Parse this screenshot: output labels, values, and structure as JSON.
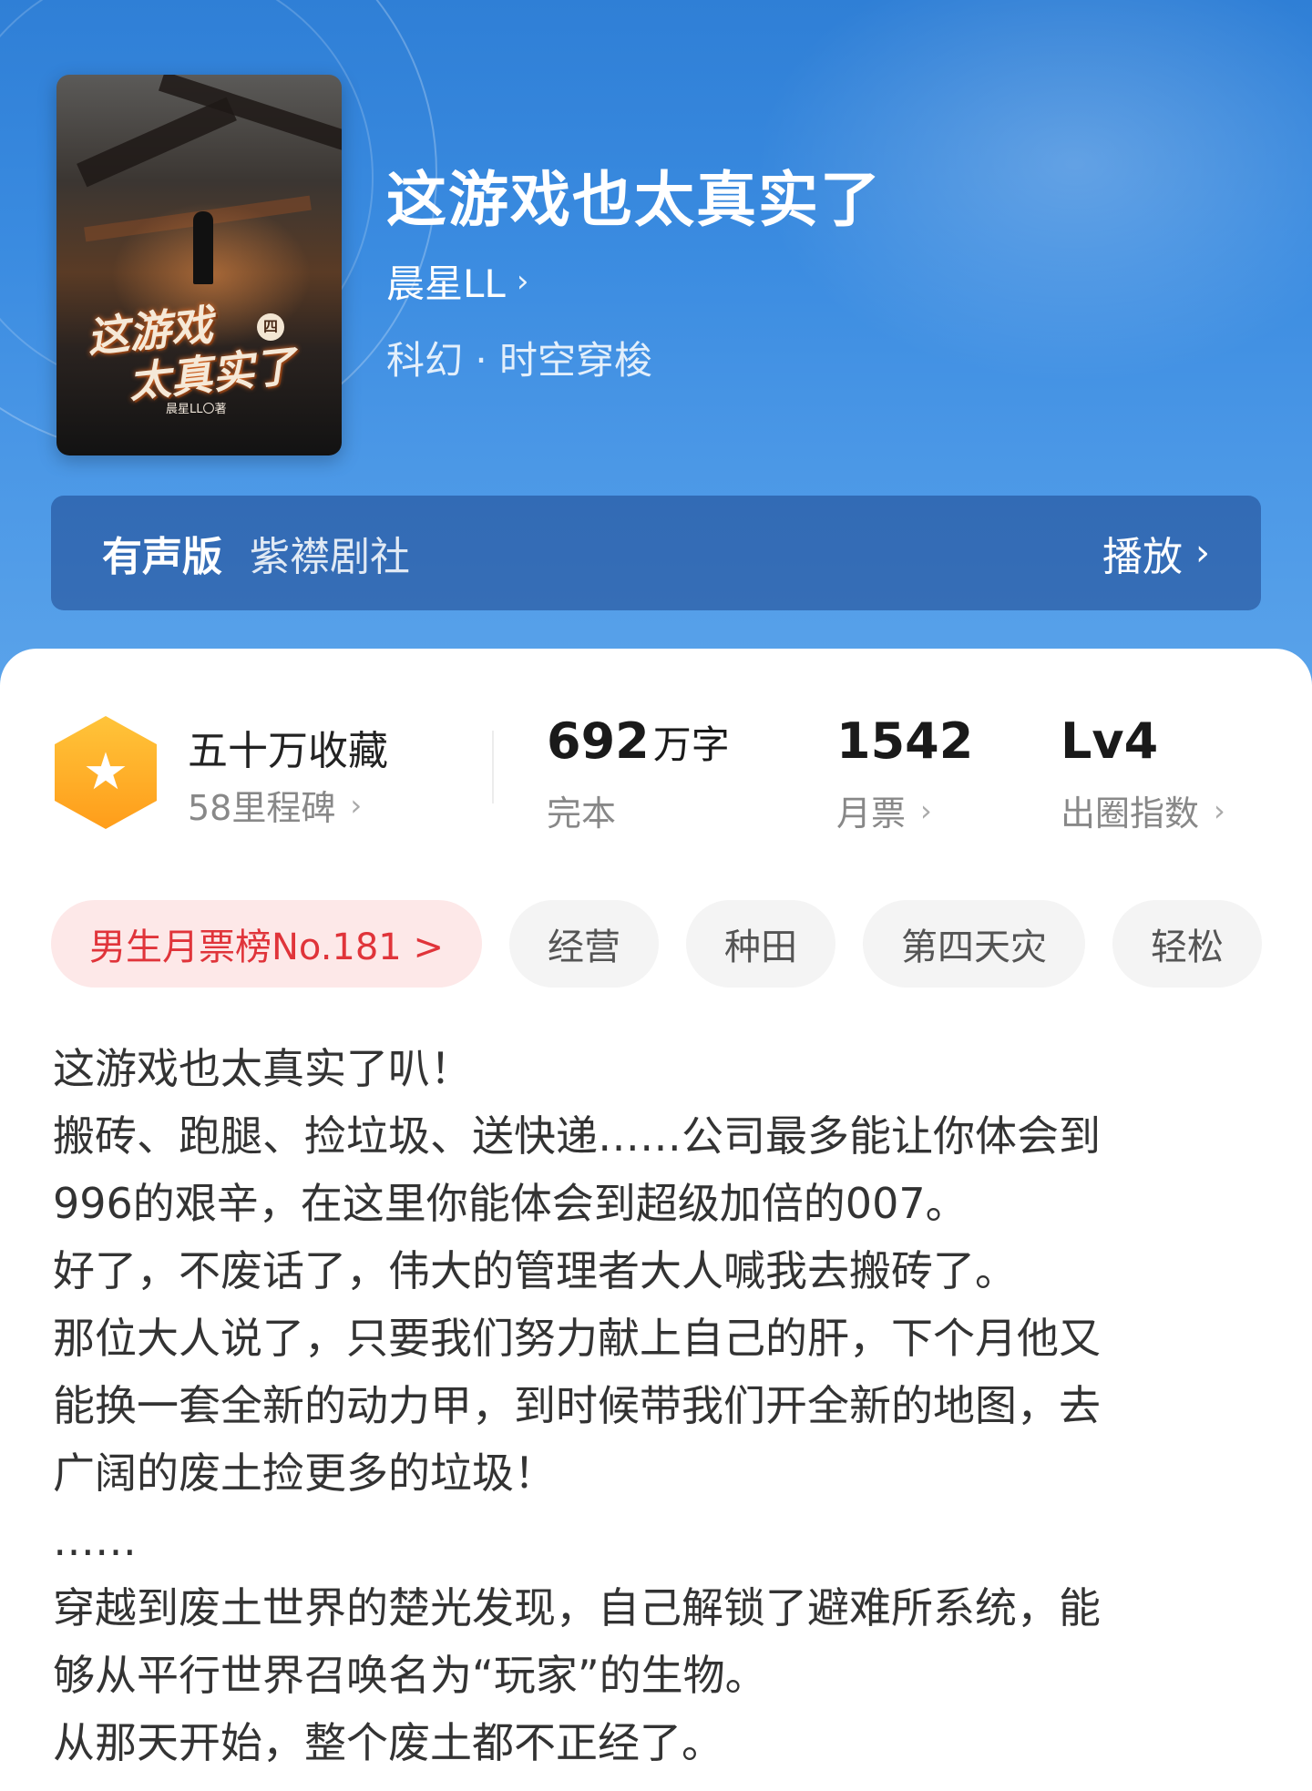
{
  "book": {
    "title": "这游戏也太真实了",
    "author": "晨星LL",
    "genre": "科幻 · 时空穿梭",
    "cover": {
      "title_line1": "这游戏",
      "title_line2": "太真实了",
      "badge": "四",
      "author": "晨星LL〇著"
    }
  },
  "audio": {
    "label": "有声版",
    "studio": "紫襟剧社",
    "play_label": "播放"
  },
  "stats": {
    "favorites": {
      "title": "五十万收藏",
      "subtitle": "58里程碑"
    },
    "words": {
      "value": "692",
      "unit": "万字",
      "label": "完本"
    },
    "tickets": {
      "value": "1542",
      "label": "月票"
    },
    "level": {
      "value": "Lv4",
      "label": "出圈指数"
    }
  },
  "tags": [
    {
      "label": "男生月票榜No.181 >"
    },
    {
      "label": "经营"
    },
    {
      "label": "种田"
    },
    {
      "label": "第四天灾"
    },
    {
      "label": "轻松"
    }
  ],
  "description": [
    "这游戏也太真实了叭！",
    "搬砖、跑腿、捡垃圾、送快递……公司最多能让你体会到",
    "996的艰辛，在这里你能体会到超级加倍的007。",
    "好了，不废话了，伟大的管理者大人喊我去搬砖了。",
    "那位大人说了，只要我们努力献上自己的肝，下个月他又",
    "能换一套全新的动力甲，到时候带我们开全新的地图，去",
    "广阔的废土捡更多的垃圾！",
    "……",
    "穿越到废土世界的楚光发现，自己解锁了避难所系统，能",
    "够从平行世界召唤名为“玩家”的生物。",
    "从那天开始，整个废土都不正经了。"
  ],
  "icons": {
    "medal": "star-hexagon-icon",
    "chevron": "chevron-right-icon"
  },
  "colors": {
    "header_blue": "#3a8be0",
    "rank_tag_text": "#e0343a",
    "rank_tag_bg": "#fde8e8",
    "medal_orange": "#ffa41f"
  }
}
